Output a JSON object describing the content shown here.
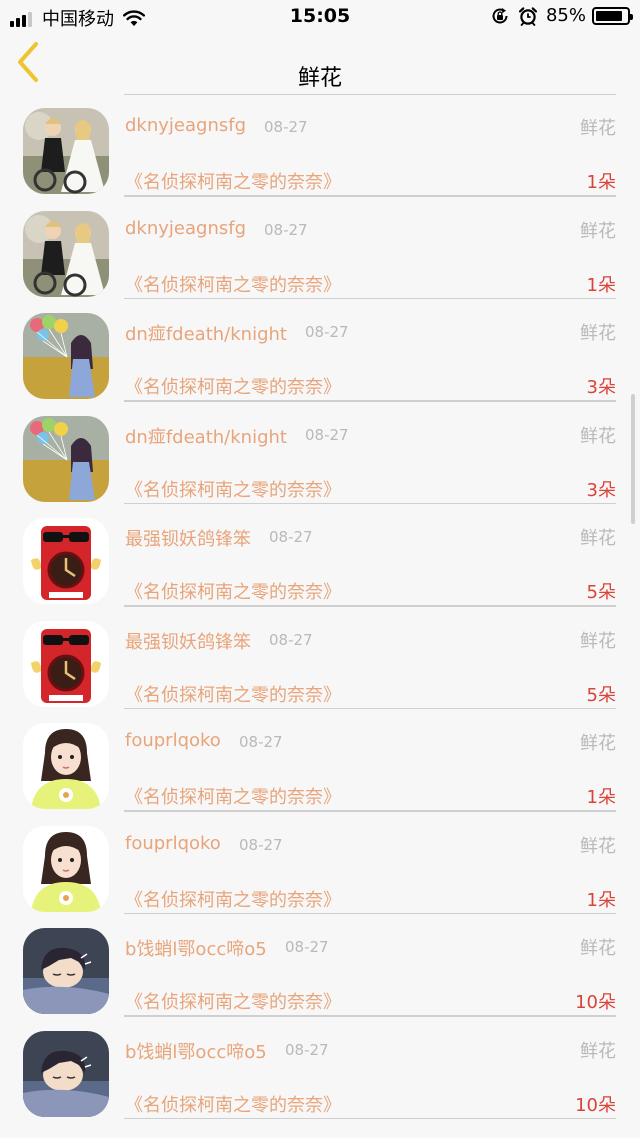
{
  "status_bar": {
    "carrier": "中国移动",
    "time": "15:05",
    "battery_percent": "85%",
    "battery_level": 0.85,
    "signal_icon": "signal-bars-icon",
    "wifi_icon": "wifi-icon",
    "lock_icon": "rotation-lock-icon",
    "alarm_icon": "alarm-icon"
  },
  "nav": {
    "back_icon": "chevron-left-icon",
    "title": "鲜花"
  },
  "colors": {
    "accent": "#e8a47a",
    "amount": "#d9443a",
    "muted": "#b9b9b9",
    "back_chevron": "#f0c431"
  },
  "records": [
    {
      "user": "dknyjeagnsfg",
      "date": "08-27",
      "gift": "鲜花",
      "work": "《名侦探柯南之零的奈奈》",
      "amount": "1朵",
      "avatar": "wedding-couple"
    },
    {
      "user": "dknyjeagnsfg",
      "date": "08-27",
      "gift": "鲜花",
      "work": "《名侦探柯南之零的奈奈》",
      "amount": "1朵",
      "avatar": "wedding-couple"
    },
    {
      "user": "dn痖fdeath/knight",
      "date": "08-27",
      "gift": "鲜花",
      "work": "《名侦探柯南之零的奈奈》",
      "amount": "3朵",
      "avatar": "girl-balloons"
    },
    {
      "user": "dn痖fdeath/knight",
      "date": "08-27",
      "gift": "鲜花",
      "work": "《名侦探柯南之零的奈奈》",
      "amount": "3朵",
      "avatar": "girl-balloons"
    },
    {
      "user": "最强钡妖鸽锋笨",
      "date": "08-27",
      "gift": "鲜花",
      "work": "《名侦探柯南之零的奈奈》",
      "amount": "5朵",
      "avatar": "red-can-mascot"
    },
    {
      "user": "最强钡妖鸽锋笨",
      "date": "08-27",
      "gift": "鲜花",
      "work": "《名侦探柯南之零的奈奈》",
      "amount": "5朵",
      "avatar": "red-can-mascot"
    },
    {
      "user": "fouprlqoko",
      "date": "08-27",
      "gift": "鲜花",
      "work": "《名侦探柯南之零的奈奈》",
      "amount": "1朵",
      "avatar": "anime-girl-yellow"
    },
    {
      "user": "fouprlqoko",
      "date": "08-27",
      "gift": "鲜花",
      "work": "《名侦探柯南之零的奈奈》",
      "amount": "1朵",
      "avatar": "anime-girl-yellow"
    },
    {
      "user": "b饯蛸l鄂occ啼o5",
      "date": "08-27",
      "gift": "鲜花",
      "work": "《名侦探柯南之零的奈奈》",
      "amount": "10朵",
      "avatar": "sleeping-anime-boy"
    },
    {
      "user": "b饯蛸l鄂occ啼o5",
      "date": "08-27",
      "gift": "鲜花",
      "work": "《名侦探柯南之零的奈奈》",
      "amount": "10朵",
      "avatar": "sleeping-anime-boy"
    }
  ]
}
